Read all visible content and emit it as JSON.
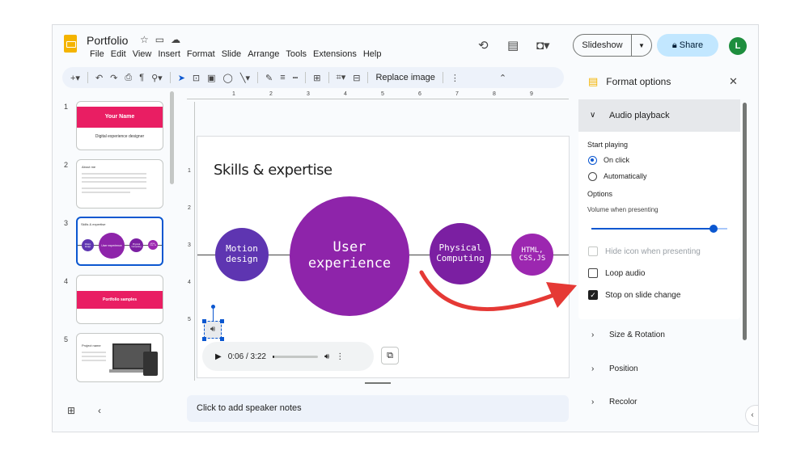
{
  "header": {
    "doc_title": "Portfolio",
    "menu": [
      "File",
      "Edit",
      "View",
      "Insert",
      "Format",
      "Slide",
      "Arrange",
      "Tools",
      "Extensions",
      "Help"
    ],
    "slideshow_label": "Slideshow",
    "share_label": "Share",
    "avatar_letter": "L"
  },
  "toolbar": {
    "replace_image_label": "Replace image"
  },
  "filmstrip": {
    "slides": [
      {
        "num": "1",
        "title": "Your Name",
        "subtitle": "Digital experience designer"
      },
      {
        "num": "2",
        "title": "About me"
      },
      {
        "num": "3",
        "title": "Skills & expertise",
        "bubbles": [
          "Motion design",
          "User experience",
          "Physical Computing",
          "HTML, CSS, JS"
        ]
      },
      {
        "num": "4",
        "title": "Portfolio samples"
      },
      {
        "num": "5",
        "title": "Project name"
      }
    ]
  },
  "ruler": {
    "h_ticks": [
      "1",
      "2",
      "3",
      "4",
      "5",
      "6",
      "7",
      "8",
      "9"
    ],
    "v_ticks": [
      "1",
      "2",
      "3",
      "4",
      "5"
    ]
  },
  "slide": {
    "title": "Skills & expertise",
    "bubbles": [
      {
        "line1": "Motion",
        "line2": "design",
        "color": "#5e35b1"
      },
      {
        "line1": "User",
        "line2": "experience",
        "color": "#8e24aa"
      },
      {
        "line1": "Physical",
        "line2": "Computing",
        "color": "#7b1fa2"
      },
      {
        "line1": "HTML,",
        "line2": "CSS,JS",
        "color": "#9c27b0"
      }
    ]
  },
  "player": {
    "time": "0:06 / 3:22",
    "progress": 0.03
  },
  "notes": {
    "placeholder": "Click to add speaker notes"
  },
  "panel": {
    "title": "Format options",
    "audio_section": "Audio playback",
    "start_playing_label": "Start playing",
    "on_click_label": "On click",
    "automatically_label": "Automatically",
    "options_label": "Options",
    "volume_label": "Volume when presenting",
    "volume": 0.9,
    "hide_icon_label": "Hide icon when presenting",
    "loop_audio_label": "Loop audio",
    "stop_on_change_label": "Stop on slide change",
    "size_rotation_label": "Size & Rotation",
    "position_label": "Position",
    "recolor_label": "Recolor"
  },
  "colors": {
    "accent_blue": "#0b57d0",
    "annotation_red": "#e53935",
    "thumb_pink": "#e91e63"
  }
}
